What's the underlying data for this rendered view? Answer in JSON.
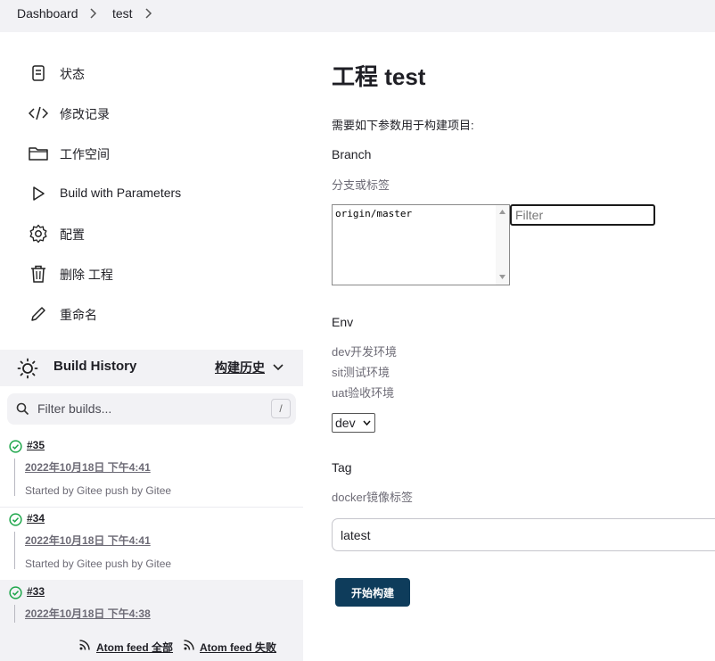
{
  "breadcrumb": {
    "items": [
      "Dashboard",
      "test"
    ]
  },
  "sidebar": {
    "items": [
      {
        "label": "状态",
        "icon": "status-icon"
      },
      {
        "label": "修改记录",
        "icon": "code-icon"
      },
      {
        "label": "工作空间",
        "icon": "folder-icon"
      },
      {
        "label": "Build with Parameters",
        "icon": "play-icon"
      },
      {
        "label": "配置",
        "icon": "gear-icon"
      },
      {
        "label": "删除 工程",
        "icon": "trash-icon"
      },
      {
        "label": "重命名",
        "icon": "pencil-icon"
      }
    ]
  },
  "build_history": {
    "title": "Build History",
    "trend_label": "构建历史",
    "filter_placeholder": "Filter builds...",
    "filter_shortcut": "/",
    "builds": [
      {
        "number": "#35",
        "date": "2022年10月18日 下午4:41",
        "cause": "Started by Gitee push by Gitee",
        "status": "success"
      },
      {
        "number": "#34",
        "date": "2022年10月18日 下午4:41",
        "cause": "Started by Gitee push by Gitee",
        "status": "success"
      },
      {
        "number": "#33",
        "date": "2022年10月18日 下午4:38",
        "status": "success"
      }
    ],
    "feeds": {
      "all": "Atom feed 全部",
      "failed": "Atom feed 失败"
    }
  },
  "main": {
    "title": "工程 test",
    "description": "需要如下参数用于构建项目:",
    "params": {
      "branch": {
        "name": "Branch",
        "desc": "分支或标签",
        "options": [
          "origin/master"
        ],
        "filter_placeholder": "Filter"
      },
      "env": {
        "name": "Env",
        "desc_lines": [
          "dev开发环境",
          "sit测试环境",
          "uat验收环境"
        ],
        "selected": "dev"
      },
      "tag": {
        "name": "Tag",
        "desc": "docker镜像标签",
        "value": "latest"
      }
    },
    "submit_label": "开始构建"
  },
  "colors": {
    "primary_button": "#0e3c5b",
    "success": "#1ea64b",
    "panel": "#f2f2f5",
    "muted_text": "#6d6b76"
  }
}
